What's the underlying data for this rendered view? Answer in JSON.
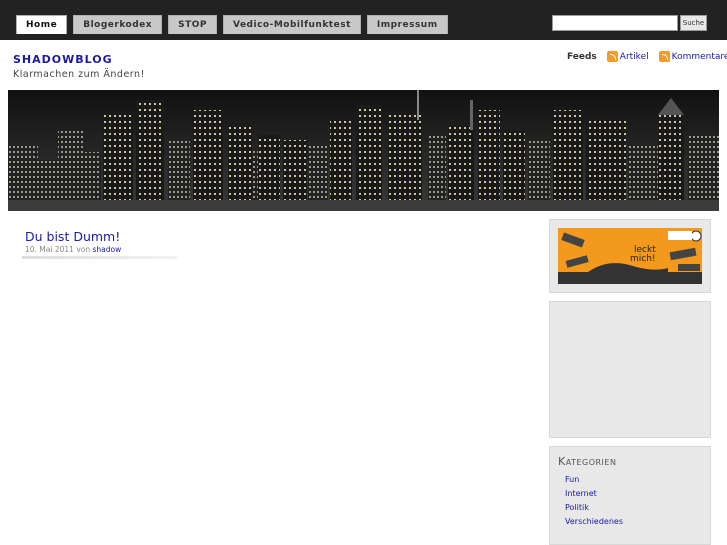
{
  "nav": {
    "tabs": [
      {
        "label": "Home"
      },
      {
        "label": "Blogerkodex"
      },
      {
        "label": "STOP"
      },
      {
        "label": "Vedico-Mobilfunktest"
      },
      {
        "label": "Impressum"
      }
    ]
  },
  "search": {
    "value": "",
    "button_label": "Suche"
  },
  "site": {
    "title": "SHADOWBLOG",
    "tagline": "Klarmachen zum Ändern!"
  },
  "feeds": {
    "label": "Feeds",
    "articles": "Artikel",
    "comments": "Kommentare",
    "icon": "rss-icon",
    "icon_color": "#f59b2a"
  },
  "post": {
    "title": "Du bist Dumm!",
    "date": "10. Mai 2011 von",
    "author": "shadow"
  },
  "sidebar": {
    "banner_text_line1": "leckt",
    "banner_text_line2": "mich!",
    "categories": {
      "title": "Kategorien",
      "items": [
        {
          "label": "Fun"
        },
        {
          "label": "Internet"
        },
        {
          "label": "Politik"
        },
        {
          "label": "Verschiedenes"
        }
      ]
    }
  },
  "colors": {
    "topbar": "#222222",
    "link": "#1a1aa5",
    "sidebar_bg": "#e8e8e8",
    "banner_orange": "#f39a1e"
  }
}
